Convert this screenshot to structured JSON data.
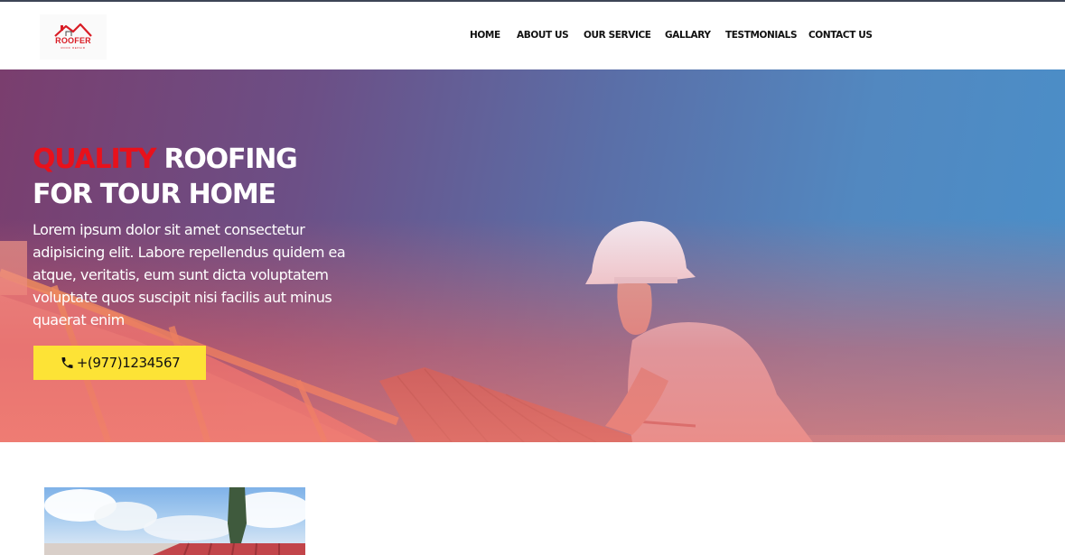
{
  "brand": {
    "logo_text": "ROOFER",
    "logo_subtext": "ROOF REPAIR",
    "accent_color": "#e8111b"
  },
  "nav": {
    "items": [
      "HOME",
      "ABOUT US",
      "OUR SERVICE",
      "GALLARY",
      "TESTMONIALS",
      "CONTACT US"
    ]
  },
  "hero": {
    "title_accent": "QUALITY",
    "title_rest": " ROOFING",
    "title_line2": "FOR TOUR HOME",
    "description": "Lorem ipsum dolor sit amet consectetur adipisicing elit. Labore repellendus quidem ea atque, veritatis, eum sunt dicta voluptatem voluptate quos suscipit nisi facilis aut minus quaerat enim",
    "phone_label": "+(977)1234567",
    "phone_icon": "phone-icon",
    "button_color": "#fde336"
  },
  "about": {
    "image": "roof-worker-photo"
  }
}
